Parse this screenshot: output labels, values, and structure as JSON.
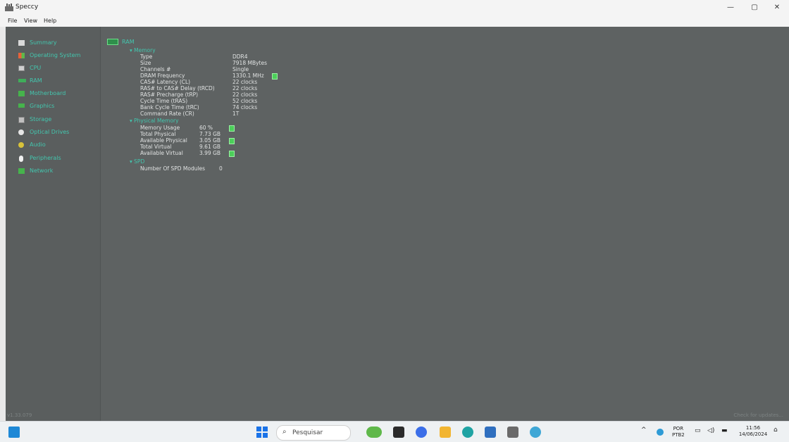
{
  "window": {
    "title": "Speccy",
    "minimize": "—",
    "maximize": "▢",
    "close": "✕"
  },
  "menu": [
    "File",
    "View",
    "Help"
  ],
  "sidebar": {
    "items": [
      {
        "label": "Summary",
        "icon": "summary-icon",
        "color": "#d9d9d9"
      },
      {
        "label": "Operating System",
        "icon": "windows-icon",
        "color": "#e8a13a"
      },
      {
        "label": "CPU",
        "icon": "cpu-icon",
        "color": "#cfcfcf"
      },
      {
        "label": "RAM",
        "icon": "ram-icon",
        "color": "#3fae5a"
      },
      {
        "label": "Motherboard",
        "icon": "motherboard-icon",
        "color": "#46b34c"
      },
      {
        "label": "Graphics",
        "icon": "graphics-icon",
        "color": "#46b34c"
      },
      {
        "label": "Storage",
        "icon": "storage-icon",
        "color": "#bfbfbf"
      },
      {
        "label": "Optical Drives",
        "icon": "disc-icon",
        "color": "#e6e6e6"
      },
      {
        "label": "Audio",
        "icon": "audio-icon",
        "color": "#d8c23a"
      },
      {
        "label": "Peripherals",
        "icon": "mouse-icon",
        "color": "#f0f0f0"
      },
      {
        "label": "Network",
        "icon": "network-icon",
        "color": "#46b34c"
      }
    ]
  },
  "content": {
    "header": "RAM",
    "memory": {
      "section": "Memory",
      "rows": [
        {
          "label": "Type",
          "value": "DDR4"
        },
        {
          "label": "Size",
          "value": "7918 MBytes"
        },
        {
          "label": "Channels #",
          "value": "Single"
        },
        {
          "label": "DRAM Frequency",
          "value": "1330.1 MHz"
        },
        {
          "label": "CAS# Latency (CL)",
          "value": "22 clocks"
        },
        {
          "label": "RAS# to CAS# Delay (tRCD)",
          "value": "22 clocks"
        },
        {
          "label": "RAS# Precharge (tRP)",
          "value": "22 clocks"
        },
        {
          "label": "Cycle Time (tRAS)",
          "value": "52 clocks"
        },
        {
          "label": "Bank Cycle Time (tRC)",
          "value": "74 clocks"
        },
        {
          "label": "Command Rate (CR)",
          "value": "1T"
        }
      ]
    },
    "physical": {
      "section": "Physical Memory",
      "rows": [
        {
          "label": "Memory Usage",
          "value": "60 %"
        },
        {
          "label": "Total Physical",
          "value": "7.73 GB"
        },
        {
          "label": "Available Physical",
          "value": "3.05 GB"
        },
        {
          "label": "Total Virtual",
          "value": "9.61 GB"
        },
        {
          "label": "Available Virtual",
          "value": "3.99 GB"
        }
      ]
    },
    "spd": {
      "section": "SPD",
      "rows": [
        {
          "label": "Number Of SPD Modules",
          "value": "0"
        }
      ]
    }
  },
  "status": {
    "version": "v1.33.079",
    "update": "Check for updates..."
  },
  "taskbar": {
    "search": "Pesquisar",
    "lang_top": "POR",
    "lang_bottom": "PTB2",
    "time": "11:56",
    "date": "14/06/2024"
  }
}
